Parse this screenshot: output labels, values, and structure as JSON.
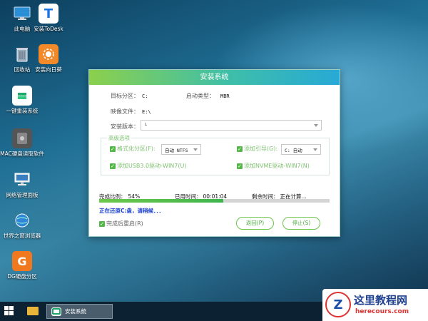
{
  "desktop_icons": [
    {
      "label": "此电脑",
      "icon": "computer-icon"
    },
    {
      "label": "安装ToDesk",
      "icon": "todesk-icon"
    },
    {
      "label": "回收站",
      "icon": "recycle-bin-icon"
    },
    {
      "label": "安装向日葵",
      "icon": "sunflower-icon"
    },
    {
      "label": "一键重装系统",
      "icon": "reinstall-icon"
    },
    {
      "label": "MAC硬盘读取软件",
      "icon": "mac-disk-icon"
    },
    {
      "label": "网络管理面板",
      "icon": "network-icon"
    },
    {
      "label": "世界之窗浏览器",
      "icon": "browser-icon"
    },
    {
      "label": "DG硬盘分区",
      "icon": "diskgenius-icon"
    }
  ],
  "dialog": {
    "title": "安装系统",
    "target_partition_label": "目标分区：",
    "target_partition_value": "C:",
    "boot_type_label": "启动类型：",
    "boot_type_value": "MBR",
    "image_file_label": "映像文件：",
    "image_file_value": "E:\\",
    "install_version_label": "安装版本：",
    "install_version_value": "└",
    "advanced_label": "高级选项",
    "format_partition_label": "格式化分区(F):",
    "format_partition_value": "自动 NTFS",
    "add_boot_label": "添加引导(G):",
    "add_boot_value": "C: 自动",
    "usb3_label": "添加USB3.0驱动-WIN7(U)",
    "nvme_label": "添加NVME驱动-WIN7(N)",
    "progress_label": "完成比例：",
    "progress_value": "54%",
    "progress_fraction": 0.54,
    "elapsed_label": "已用时间：",
    "elapsed_value": "00:01:04",
    "remaining_label": "剩余时间：",
    "remaining_value": "正在计算...",
    "status_text": "正在还原C:盘，请稍候．．．",
    "reboot_label": "完成后重启(R)",
    "back_button": "返回(P)",
    "stop_button": "停止(S)"
  },
  "taskbar": {
    "active_task": "安装系统"
  },
  "watermark": {
    "logo_letter": "Z",
    "cn": "这里教程网",
    "en": "herecours.com"
  },
  "colors": {
    "accent_green": "#55b74a",
    "title_gradient_start": "#8cd04c",
    "title_gradient_end": "#27a9d6",
    "status_blue": "#1a3fd1"
  }
}
